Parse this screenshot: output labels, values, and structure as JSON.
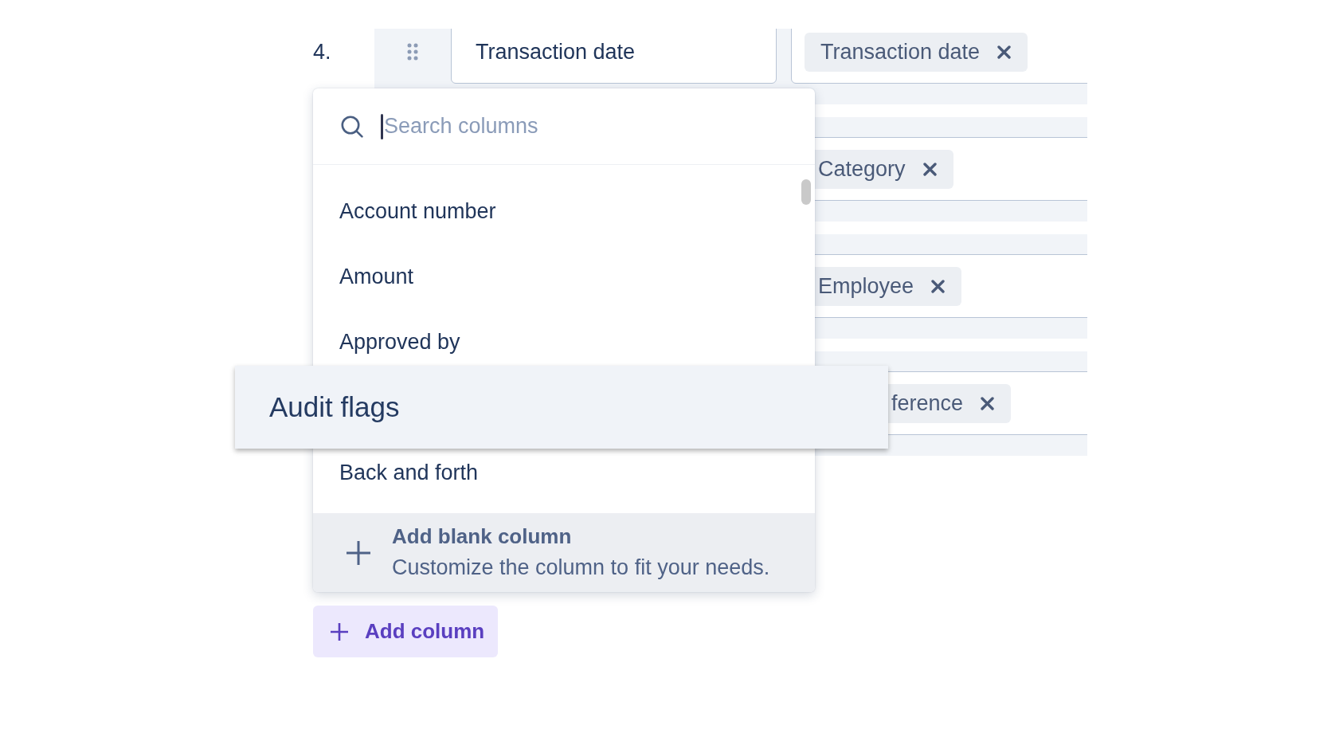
{
  "columns_list": {
    "rows": [
      {
        "number": "4.",
        "field": {
          "value": "Transaction date"
        },
        "tag": {
          "label": "Transaction date"
        }
      },
      {
        "tag": {
          "label": "Category"
        }
      },
      {
        "tag": {
          "label": "Employee"
        }
      },
      {
        "tag": {
          "label": "ference"
        }
      }
    ]
  },
  "column_menu": {
    "search": {
      "placeholder": "Search columns"
    },
    "items": [
      {
        "label": "Account number",
        "dragging": false
      },
      {
        "label": "Amount",
        "dragging": false
      },
      {
        "label": "Approved by",
        "dragging": false
      },
      {
        "label": "Audit flags",
        "dragging": true
      },
      {
        "label": "Back and forth",
        "dragging": false
      }
    ],
    "footer": {
      "title": "Add blank column",
      "subtitle": "Customize the column to fit your needs."
    }
  },
  "add_column_button": {
    "label": "Add column"
  }
}
